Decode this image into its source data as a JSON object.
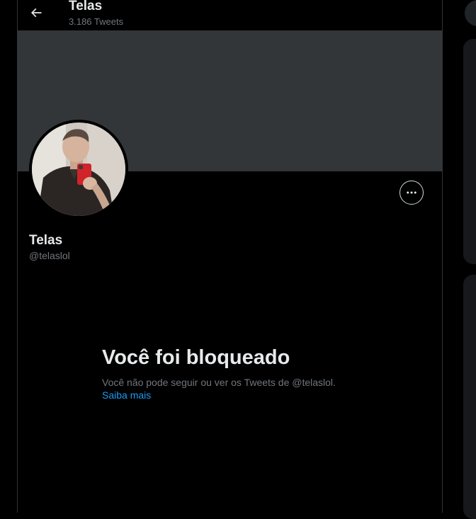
{
  "header": {
    "title": "Telas",
    "subtitle": "3.186 Tweets",
    "back_icon": "arrow-left-icon"
  },
  "profile": {
    "name": "Telas",
    "handle": "@telaslol",
    "banner_color": "#333639",
    "more_icon": "more-horizontal-icon"
  },
  "blocked": {
    "title": "Você foi bloqueado",
    "message": "Você não pode seguir ou ver os Tweets de @telaslol.",
    "link": "Saiba mais"
  },
  "colors": {
    "background": "#000000",
    "text_primary": "#e7e9ea",
    "text_secondary": "#71767b",
    "link": "#1d9bf0",
    "border": "#2f3336"
  }
}
